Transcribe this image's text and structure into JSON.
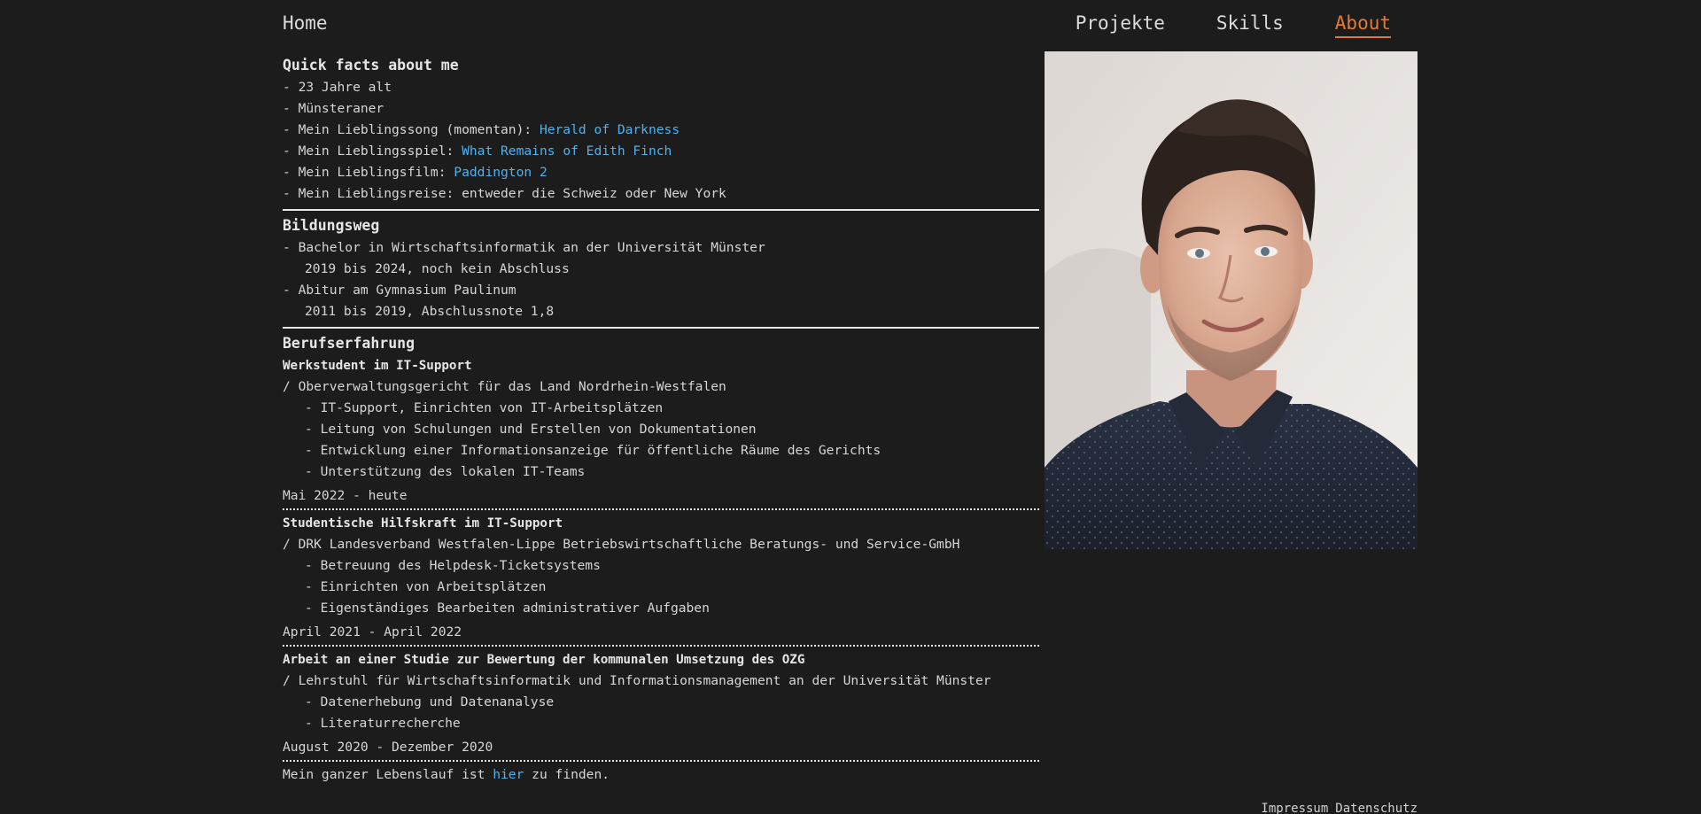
{
  "nav": {
    "home": "Home",
    "links": [
      "Projekte",
      "Skills",
      "About"
    ],
    "active": "About",
    "accent_color": "#e07b39"
  },
  "quick_facts": {
    "title": "Quick facts about me",
    "items": [
      {
        "text": "- 23 Jahre alt"
      },
      {
        "text": "- Münsteraner"
      },
      {
        "text": "- Mein Lieblingssong (momentan): ",
        "link": "Herald of Darkness"
      },
      {
        "text": "- Mein Lieblingsspiel: ",
        "link": "What Remains of Edith Finch"
      },
      {
        "text": "- Mein Lieblingsfilm: ",
        "link": "Paddington 2"
      },
      {
        "text": "- Mein Lieblingsreise: entweder die Schweiz oder New York"
      }
    ]
  },
  "education": {
    "title": "Bildungsweg",
    "items": [
      {
        "line": "- Bachelor in Wirtschaftsinformatik an der Universität Münster",
        "detail": "2019 bis 2024, noch kein Abschluss"
      },
      {
        "line": "- Abitur am Gymnasium Paulinum",
        "detail": "2011 bis 2019, Abschlussnote 1,8"
      }
    ]
  },
  "experience": {
    "title": "Berufserfahrung",
    "jobs": [
      {
        "title": "Werkstudent im IT-Support",
        "org": "/ Oberverwaltungsgericht für das Land Nordrhein-Westfalen",
        "tasks": [
          "- IT-Support, Einrichten von IT-Arbeitsplätzen",
          "- Leitung von Schulungen und Erstellen von Dokumentationen",
          "- Entwicklung einer Informationsanzeige für öffentliche Räume des Gerichts",
          "- Unterstützung des lokalen IT-Teams"
        ],
        "period": "Mai 2022 - heute"
      },
      {
        "title": "Studentische Hilfskraft im IT-Support",
        "org": "/ DRK Landesverband Westfalen-Lippe Betriebswirtschaftliche Beratungs- und Service-GmbH",
        "tasks": [
          "- Betreuung des Helpdesk-Ticketsystems",
          "- Einrichten von Arbeitsplätzen",
          "- Eigenständiges Bearbeiten administrativer Aufgaben"
        ],
        "period": "April 2021 - April 2022"
      },
      {
        "title": "Arbeit an einer Studie zur Bewertung der kommunalen Umsetzung des OZG",
        "org": "/ Lehrstuhl für Wirtschaftsinformatik und Informationsmanagement an der Universität Münster",
        "tasks": [
          "- Datenerhebung und Datenanalyse",
          "- Literaturrecherche"
        ],
        "period": "August 2020 - Dezember 2020"
      }
    ]
  },
  "cv": {
    "before": "Mein ganzer Lebenslauf ist ",
    "link": "hier",
    "after": " zu finden."
  },
  "footer": {
    "impressum": "Impressum",
    "datenschutz": "Datenschutz"
  },
  "colors": {
    "background": "#1c1c1c",
    "text": "#d6d6d6",
    "link": "#4cb2f0",
    "accent": "#e07b39"
  }
}
